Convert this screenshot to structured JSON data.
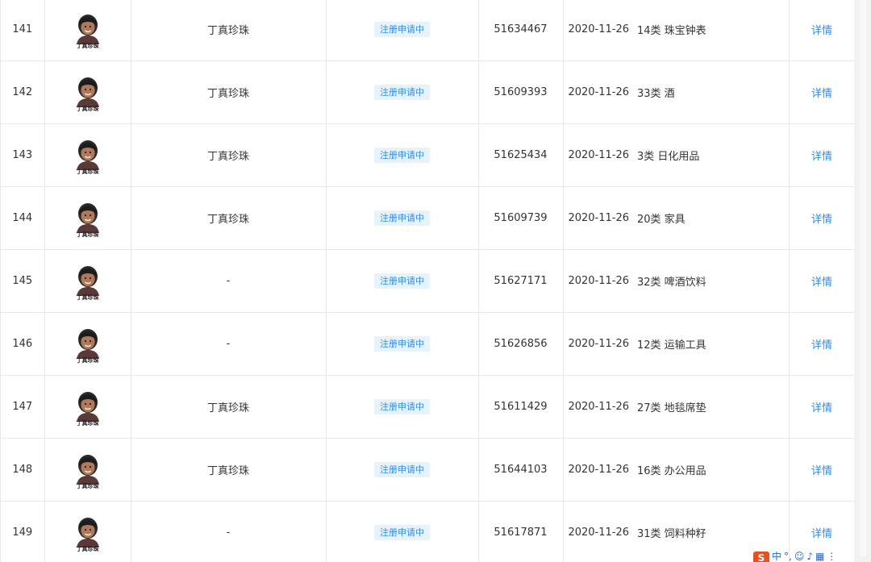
{
  "logo_text": "丁真珍珠",
  "status_label": "注册申请中",
  "detail_label": "详情",
  "rows": [
    {
      "num": "141",
      "name": "丁真珍珠",
      "regno": "51634467",
      "date": "2020-11-26",
      "class": "14类 珠宝钟表"
    },
    {
      "num": "142",
      "name": "丁真珍珠",
      "regno": "51609393",
      "date": "2020-11-26",
      "class": "33类 酒"
    },
    {
      "num": "143",
      "name": "丁真珍珠",
      "regno": "51625434",
      "date": "2020-11-26",
      "class": "3类 日化用品"
    },
    {
      "num": "144",
      "name": "丁真珍珠",
      "regno": "51609739",
      "date": "2020-11-26",
      "class": "20类 家具"
    },
    {
      "num": "145",
      "name": "-",
      "regno": "51627171",
      "date": "2020-11-26",
      "class": "32类 啤酒饮料"
    },
    {
      "num": "146",
      "name": "-",
      "regno": "51626856",
      "date": "2020-11-26",
      "class": "12类 运输工具"
    },
    {
      "num": "147",
      "name": "丁真珍珠",
      "regno": "51611429",
      "date": "2020-11-26",
      "class": "27类 地毯席垫"
    },
    {
      "num": "148",
      "name": "丁真珍珠",
      "regno": "51644103",
      "date": "2020-11-26",
      "class": "16类 办公用品"
    },
    {
      "num": "149",
      "name": "-",
      "regno": "51617871",
      "date": "2020-11-26",
      "class": "31类 饲料种籽"
    }
  ],
  "ime": {
    "logo": "S",
    "lang": "中",
    "items": [
      "°,",
      "☺",
      "♪",
      "▦",
      "⋮"
    ]
  },
  "colors": {
    "accent": "#2d8cf0",
    "badge_bg": "#e6f3fc",
    "border": "#e8e8e8",
    "ime_brand": "#e8501c"
  }
}
